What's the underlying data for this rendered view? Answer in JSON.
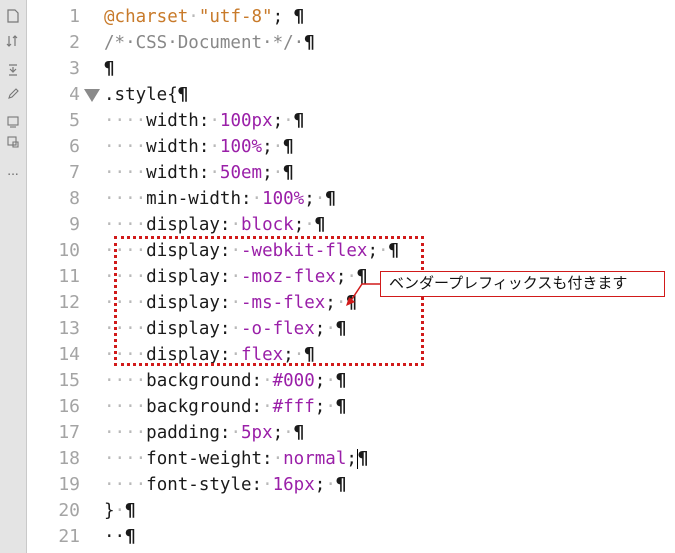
{
  "toolbar": {
    "icons": [
      "document-icon",
      "sort-icon",
      "collapse-icon",
      "edit-icon",
      "snippet-icon",
      "code-hint-icon",
      "more-icon"
    ],
    "more_label": "..."
  },
  "editor": {
    "lines": [
      {
        "num": "1",
        "tokens": [
          [
            "kw",
            "@charset"
          ],
          [
            "ws",
            "·"
          ],
          [
            "str",
            "\"utf-8\""
          ],
          [
            "prop",
            "; "
          ]
        ]
      },
      {
        "num": "2",
        "tokens": [
          [
            "cm",
            "/*·CSS·Document·*/·"
          ]
        ]
      },
      {
        "num": "3",
        "tokens": [
          [
            "prop",
            ""
          ]
        ]
      },
      {
        "num": "4",
        "fold": true,
        "tokens": [
          [
            "prop",
            ".style{"
          ]
        ]
      },
      {
        "num": "5",
        "tokens": [
          [
            "ws",
            "····"
          ],
          [
            "prop",
            "width:"
          ],
          [
            "ws",
            "·"
          ],
          [
            "val",
            "100px"
          ],
          [
            "prop",
            ";"
          ],
          [
            "ws",
            "·"
          ]
        ]
      },
      {
        "num": "6",
        "tokens": [
          [
            "ws",
            "····"
          ],
          [
            "prop",
            "width:"
          ],
          [
            "ws",
            "·"
          ],
          [
            "val",
            "100%"
          ],
          [
            "prop",
            ";"
          ],
          [
            "ws",
            "·"
          ]
        ]
      },
      {
        "num": "7",
        "tokens": [
          [
            "ws",
            "····"
          ],
          [
            "prop",
            "width:"
          ],
          [
            "ws",
            "·"
          ],
          [
            "val",
            "50em"
          ],
          [
            "prop",
            ";"
          ],
          [
            "ws",
            "·"
          ]
        ]
      },
      {
        "num": "8",
        "tokens": [
          [
            "ws",
            "····"
          ],
          [
            "prop",
            "min-width:"
          ],
          [
            "ws",
            "·"
          ],
          [
            "val",
            "100%"
          ],
          [
            "prop",
            ";"
          ],
          [
            "ws",
            "·"
          ]
        ]
      },
      {
        "num": "9",
        "tokens": [
          [
            "ws",
            "····"
          ],
          [
            "prop",
            "display:"
          ],
          [
            "ws",
            "·"
          ],
          [
            "val",
            "block"
          ],
          [
            "prop",
            ";"
          ],
          [
            "ws",
            "·"
          ]
        ]
      },
      {
        "num": "10",
        "tokens": [
          [
            "ws",
            "····"
          ],
          [
            "prop",
            "display:"
          ],
          [
            "ws",
            "·"
          ],
          [
            "val",
            "-webkit-flex"
          ],
          [
            "prop",
            ";"
          ],
          [
            "ws",
            "·"
          ]
        ]
      },
      {
        "num": "11",
        "tokens": [
          [
            "ws",
            "····"
          ],
          [
            "prop",
            "display:"
          ],
          [
            "ws",
            "·"
          ],
          [
            "val",
            "-moz-flex"
          ],
          [
            "prop",
            ";"
          ],
          [
            "ws",
            "·"
          ]
        ]
      },
      {
        "num": "12",
        "tokens": [
          [
            "ws",
            "····"
          ],
          [
            "prop",
            "display:"
          ],
          [
            "ws",
            "·"
          ],
          [
            "val",
            "-ms-flex"
          ],
          [
            "prop",
            ";"
          ],
          [
            "ws",
            "·"
          ]
        ]
      },
      {
        "num": "13",
        "tokens": [
          [
            "ws",
            "····"
          ],
          [
            "prop",
            "display:"
          ],
          [
            "ws",
            "·"
          ],
          [
            "val",
            "-o-flex"
          ],
          [
            "prop",
            ";"
          ],
          [
            "ws",
            "·"
          ]
        ]
      },
      {
        "num": "14",
        "tokens": [
          [
            "ws",
            "····"
          ],
          [
            "prop",
            "display:"
          ],
          [
            "ws",
            "·"
          ],
          [
            "val",
            "flex"
          ],
          [
            "prop",
            ";"
          ],
          [
            "ws",
            "·"
          ]
        ]
      },
      {
        "num": "15",
        "tokens": [
          [
            "ws",
            "····"
          ],
          [
            "prop",
            "background:"
          ],
          [
            "ws",
            "·"
          ],
          [
            "val",
            "#000"
          ],
          [
            "prop",
            ";"
          ],
          [
            "ws",
            "·"
          ]
        ]
      },
      {
        "num": "16",
        "tokens": [
          [
            "ws",
            "····"
          ],
          [
            "prop",
            "background:"
          ],
          [
            "ws",
            "·"
          ],
          [
            "val",
            "#fff"
          ],
          [
            "prop",
            ";"
          ],
          [
            "ws",
            "·"
          ]
        ]
      },
      {
        "num": "17",
        "tokens": [
          [
            "ws",
            "····"
          ],
          [
            "prop",
            "padding:"
          ],
          [
            "ws",
            "·"
          ],
          [
            "val",
            "5px"
          ],
          [
            "prop",
            ";"
          ],
          [
            "ws",
            "·"
          ]
        ]
      },
      {
        "num": "18",
        "caret": true,
        "tokens": [
          [
            "ws",
            "····"
          ],
          [
            "prop",
            "font-weight:"
          ],
          [
            "ws",
            "·"
          ],
          [
            "val",
            "normal"
          ],
          [
            "prop",
            ";"
          ]
        ]
      },
      {
        "num": "19",
        "tokens": [
          [
            "ws",
            "····"
          ],
          [
            "prop",
            "font-style:"
          ],
          [
            "ws",
            "·"
          ],
          [
            "val",
            "16px"
          ],
          [
            "prop",
            ";"
          ],
          [
            "ws",
            "·"
          ]
        ]
      },
      {
        "num": "20",
        "tokens": [
          [
            "prop",
            "}"
          ],
          [
            "ws",
            "·"
          ]
        ]
      },
      {
        "num": "21",
        "tokens": [
          [
            "prop",
            "··"
          ]
        ]
      }
    ],
    "pilcrow": "¶"
  },
  "annotation": {
    "callout_text": "ベンダープレフィックスも付きます",
    "color": "#d11a1a"
  }
}
